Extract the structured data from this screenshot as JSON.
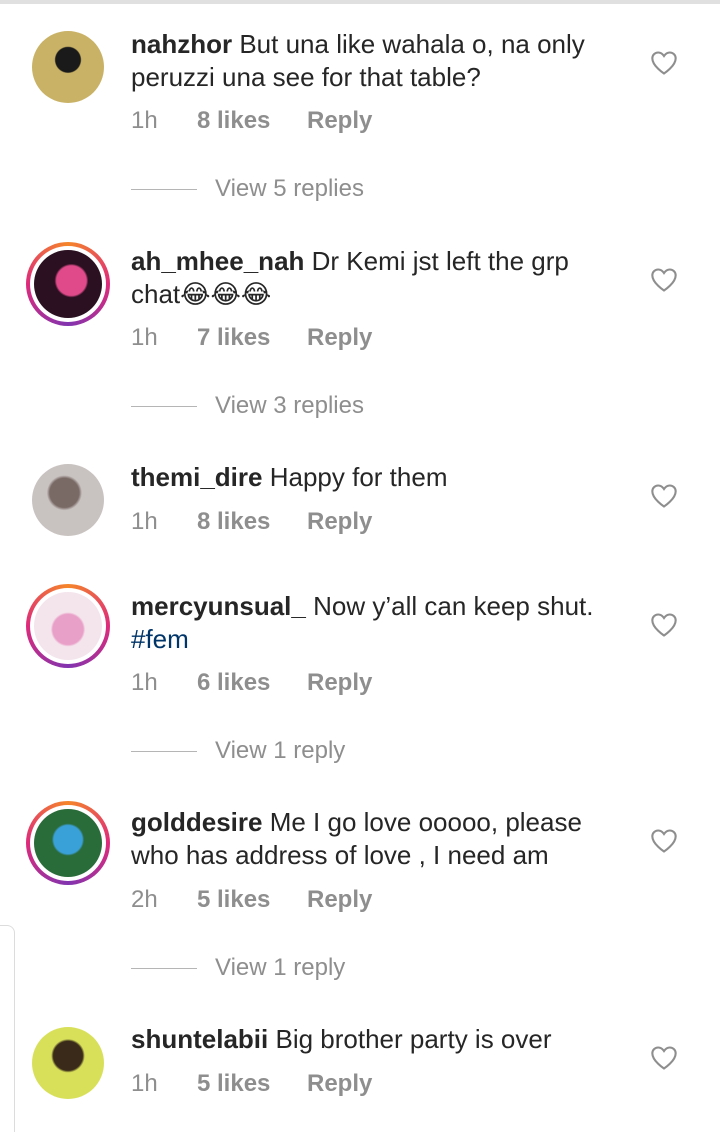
{
  "comments": [
    {
      "username": "nahzhor",
      "text_lines": [
        "But una like wahala o, na only",
        "peruzzi una see for that table?"
      ],
      "time": "1h",
      "likes": "8 likes",
      "reply": "Reply",
      "view_replies": "View 5 replies",
      "avatar_ring": false,
      "avatar_colors": [
        "#c9b266",
        "#1a1a1a"
      ]
    },
    {
      "username": "ah_mhee_nah",
      "text_lines": [
        "Dr Kemi jst left the grp",
        "chat😂😂😂"
      ],
      "time": "1h",
      "likes": "7 likes",
      "reply": "Reply",
      "view_replies": "View 3 replies",
      "avatar_ring": true,
      "avatar_colors": [
        "#e04a8a",
        "#2a1020"
      ]
    },
    {
      "username": "themi_dire",
      "text_lines": [
        "Happy for them"
      ],
      "time": "1h",
      "likes": "8 likes",
      "reply": "Reply",
      "view_replies": "",
      "avatar_ring": false,
      "avatar_colors": [
        "#c8c2c0",
        "#7a6a66"
      ]
    },
    {
      "username": "mercyunsual_",
      "text_lines": [
        "Now y’all can keep shut."
      ],
      "hashtag": "#fem",
      "time": "1h",
      "likes": "6 likes",
      "reply": "Reply",
      "view_replies": "View 1 reply",
      "avatar_ring": true,
      "avatar_colors": [
        "#e9a0c8",
        "#f4e4ec"
      ]
    },
    {
      "username": "golddesire",
      "text_lines": [
        "Me I go love  ooooo, please",
        "who has address of love , I need am"
      ],
      "time": "2h",
      "likes": "5 likes",
      "reply": "Reply",
      "view_replies": "View 1 reply",
      "avatar_ring": true,
      "avatar_colors": [
        "#3aa0d8",
        "#2a6b3a"
      ]
    },
    {
      "username": "shuntelabii",
      "text_lines": [
        "Big brother party is over"
      ],
      "time": "1h",
      "likes": "5 likes",
      "reply": "Reply",
      "view_replies": "",
      "avatar_ring": false,
      "avatar_colors": [
        "#d8e05a",
        "#3a2a1a"
      ]
    }
  ]
}
